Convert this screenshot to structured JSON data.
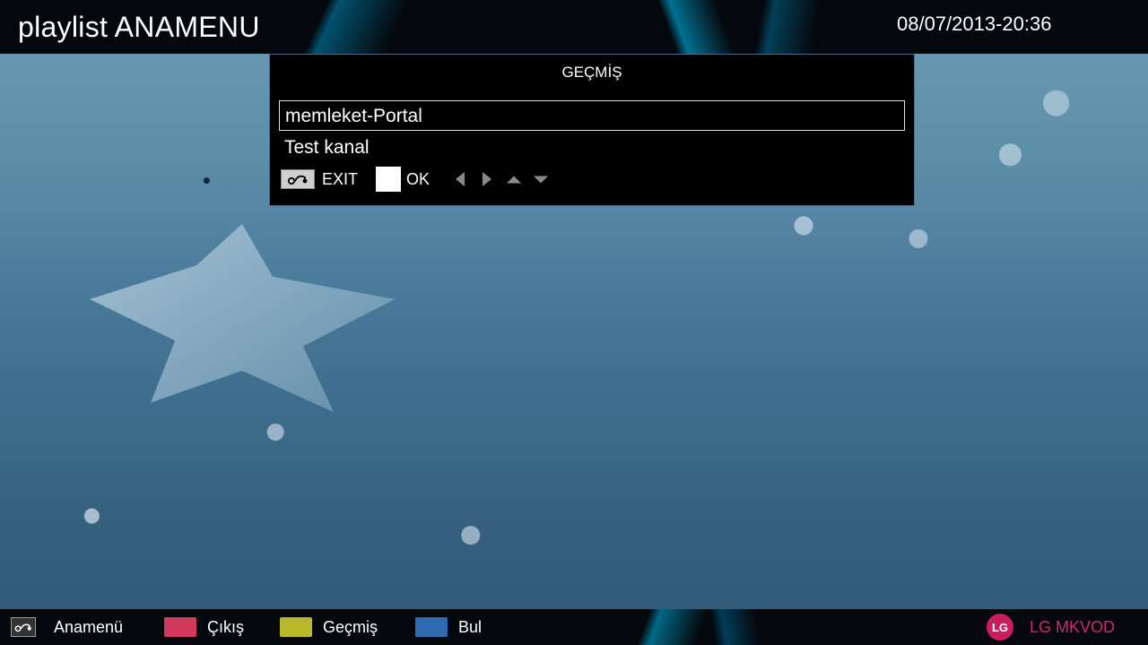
{
  "header": {
    "title": "playlist ANAMENU",
    "datetime": "08/07/2013-20:36"
  },
  "dialog": {
    "title": "GEÇMİŞ",
    "items": [
      {
        "label": "memleket-Portal",
        "selected": true
      },
      {
        "label": "Test kanal",
        "selected": false
      }
    ],
    "legend": {
      "back_icon": "back-arrow-icon",
      "exit_label": "EXIT",
      "ok_label": "OK"
    }
  },
  "footer": {
    "items": [
      {
        "label": "Anamenü",
        "icon": "back-arrow-icon"
      },
      {
        "label": "Çıkış",
        "color": "#d0385c"
      },
      {
        "label": "Geçmiş",
        "color": "#b8b82a"
      },
      {
        "label": "Bul",
        "color": "#2f6bb0"
      }
    ],
    "brand": {
      "logo_text": "LG",
      "label": "LG MKVOD",
      "color": "#d02a6b"
    }
  }
}
